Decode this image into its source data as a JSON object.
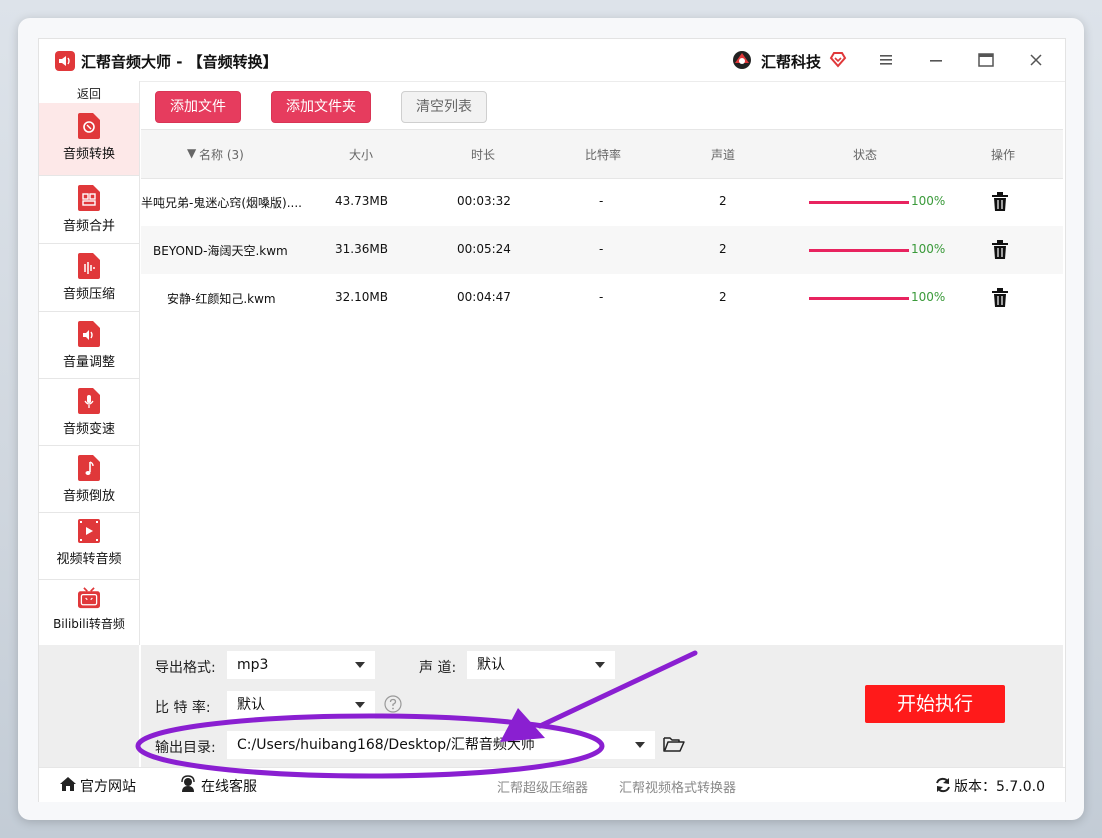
{
  "window": {
    "title": "汇帮音频大师  - 【音频转换】",
    "brand": "汇帮科技"
  },
  "sidebar": {
    "back": "返回",
    "items": [
      {
        "label": "音频转换",
        "icon": "audio-convert-icon",
        "active": true
      },
      {
        "label": "音频合并",
        "icon": "audio-merge-icon"
      },
      {
        "label": "音频压缩",
        "icon": "audio-compress-icon"
      },
      {
        "label": "音量调整",
        "icon": "volume-icon"
      },
      {
        "label": "音频变速",
        "icon": "microphone-icon"
      },
      {
        "label": "音频倒放",
        "icon": "music-note-icon"
      },
      {
        "label": "视频转音频",
        "icon": "video-icon"
      },
      {
        "label": "Bilibili转音频",
        "icon": "tv-icon"
      }
    ]
  },
  "toolbar": {
    "add_file": "添加文件",
    "add_folder": "添加文件夹",
    "clear_list": "清空列表"
  },
  "table": {
    "headers": {
      "name": "名称 (3)",
      "size": "大小",
      "duration": "时长",
      "bitrate": "比特率",
      "channels": "声道",
      "status": "状态",
      "actions": "操作"
    },
    "rows": [
      {
        "name": "半吨兄弟-鬼迷心窍(烟嗓版)....",
        "size": "43.73MB",
        "duration": "00:03:32",
        "bitrate": "-",
        "channels": "2",
        "progress": "100%"
      },
      {
        "name": "BEYOND-海阔天空.kwm",
        "size": "31.36MB",
        "duration": "00:05:24",
        "bitrate": "-",
        "channels": "2",
        "progress": "100%"
      },
      {
        "name": "安静-红颜知己.kwm",
        "size": "32.10MB",
        "duration": "00:04:47",
        "bitrate": "-",
        "channels": "2",
        "progress": "100%"
      }
    ]
  },
  "settings": {
    "format_label": "导出格式:",
    "format_value": "mp3",
    "channel_label": "声 道:",
    "channel_value": "默认",
    "bitrate_label": "比 特 率:",
    "bitrate_value": "默认",
    "output_label": "输出目录:",
    "output_value": "C:/Users/huibang168/Desktop/汇帮音频大师",
    "start_button": "开始执行"
  },
  "footer": {
    "website": "官方网站",
    "support": "在线客服",
    "link1": "汇帮超级压缩器",
    "link2": "汇帮视频格式转换器",
    "version": "版本：5.7.0.0"
  },
  "colors": {
    "accent": "#e63c5e",
    "start": "#ff1a1a",
    "annotation": "#8a1fd1",
    "progress": "#e8235f",
    "pct": "#3a9a3a"
  }
}
